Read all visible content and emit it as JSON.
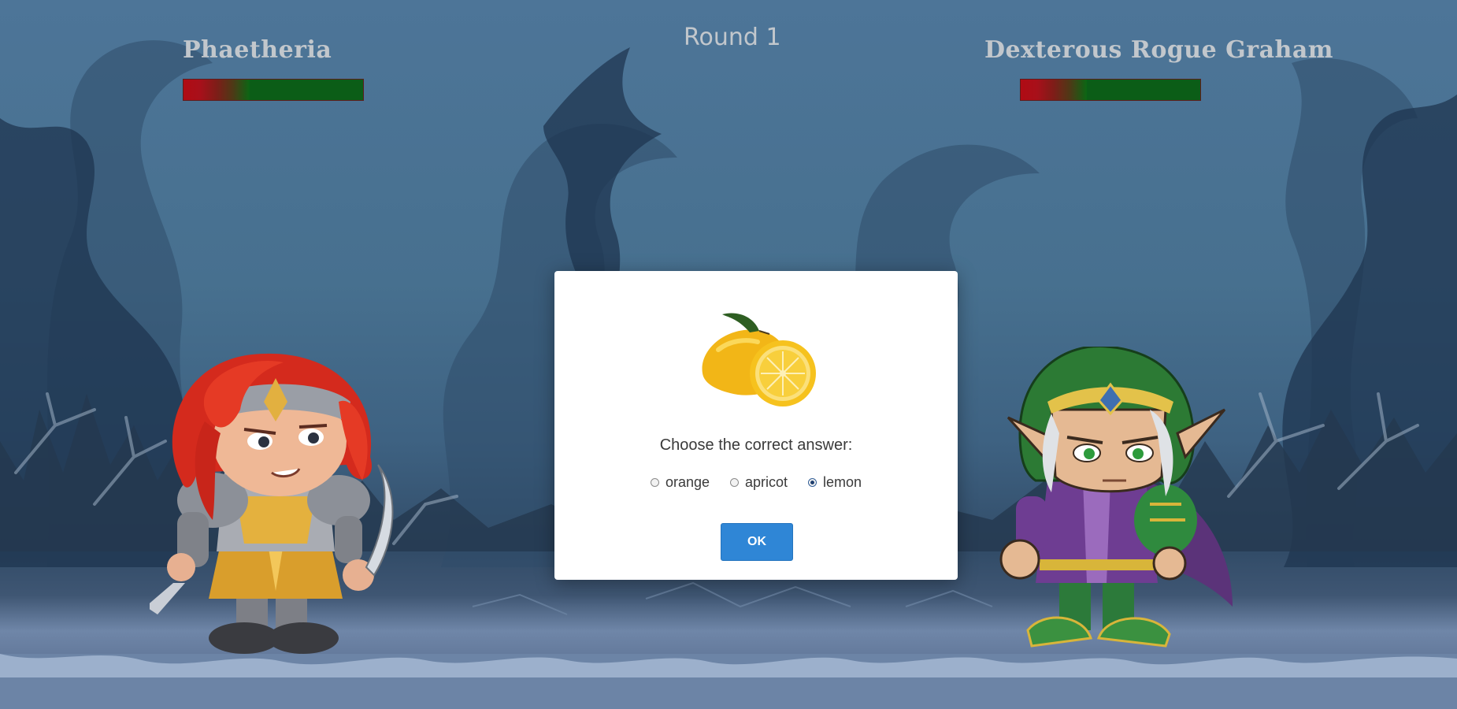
{
  "player": {
    "name": "Phaetheria",
    "health_fraction": 0.63
  },
  "enemy": {
    "name": "Dexterous Rogue Graham",
    "health_fraction": 0.63
  },
  "round_label": "Round 1",
  "quiz": {
    "image_icon": "lemon-image",
    "question": "Choose the correct answer:",
    "options": [
      {
        "label": "orange",
        "selected": false
      },
      {
        "label": "apricot",
        "selected": false
      },
      {
        "label": "lemon",
        "selected": true
      }
    ],
    "ok_label": "OK"
  },
  "colors": {
    "health_green": "#0b6614",
    "health_red": "#b00b14",
    "ok_button": "#2f86d6"
  }
}
